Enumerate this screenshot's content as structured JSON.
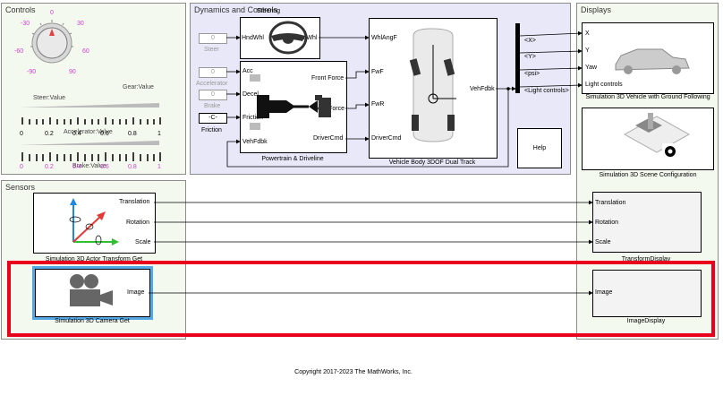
{
  "controls": {
    "title": "Controls",
    "knob_ticks": [
      "-30",
      "0",
      "30",
      "-60",
      "60",
      "-90",
      "90"
    ],
    "gear_label": "Gear:Value",
    "steer_label": "Steer:Value",
    "accel_label": "Accelerator:Value",
    "brake_label": "Brake:Value",
    "scale1": [
      "0",
      "0.2",
      "0.4",
      "0.6",
      "0.8",
      "1"
    ],
    "scale2": [
      "0",
      "0.2",
      "0.4",
      "0.6",
      "0.8",
      "1"
    ]
  },
  "dynamics": {
    "title": "Dynamics and Controls",
    "steering": {
      "title": "Steering",
      "in": "HndWhl",
      "out": "FrntWhl"
    },
    "steer_const": {
      "value": "0",
      "label": "Steer"
    },
    "accel_const": {
      "value": "0",
      "label": "Accelerator"
    },
    "decel_const": {
      "value": "0"
    },
    "brake_const": {
      "label": "Brake"
    },
    "friction_const": {
      "value": "-C-",
      "label": "Friction"
    },
    "powertrain": {
      "title": "Powertrain & Driveline",
      "in": [
        "Acc",
        "Decel",
        "Friction",
        "VehFdbk"
      ],
      "out": [
        "Front Force",
        "Rear Force",
        "DriverCmd"
      ]
    },
    "vehicle": {
      "title": "Vehicle Body 3DOF Dual Track",
      "in": [
        "WhlAngF",
        "FwF",
        "FwR",
        "DriverCmd"
      ],
      "out": "VehFdbk"
    },
    "bus": [
      "<X>",
      "<Y>",
      "<psi>",
      "<Light controls>"
    ],
    "help": "Help"
  },
  "displays": {
    "title": "Displays",
    "veh3d": {
      "in": [
        "X",
        "Y",
        "Yaw",
        "Light controls"
      ],
      "title": "Simulation 3D Vehicle with Ground Following"
    },
    "scene": {
      "title": "Simulation 3D Scene Configuration"
    },
    "transform": {
      "in": [
        "Translation",
        "Rotation",
        "Scale"
      ],
      "title": "TransformDisplay"
    },
    "image": {
      "in": "Image",
      "title": "ImageDisplay"
    }
  },
  "sensors": {
    "title": "Sensors",
    "actor": {
      "out": [
        "Translation",
        "Rotation",
        "Scale"
      ],
      "title": "Simulation 3D Actor Transform Get"
    },
    "camera": {
      "out": "Image",
      "title": "Simulation 3D Camera Get"
    }
  },
  "copyright": "Copyright 2017-2023 The MathWorks, Inc.",
  "colors": {
    "highlight": "#e8001c",
    "area_dynamics": "#e8e8f8",
    "area_other": "#f4f9ef",
    "camera_select": "#55a8e6"
  }
}
